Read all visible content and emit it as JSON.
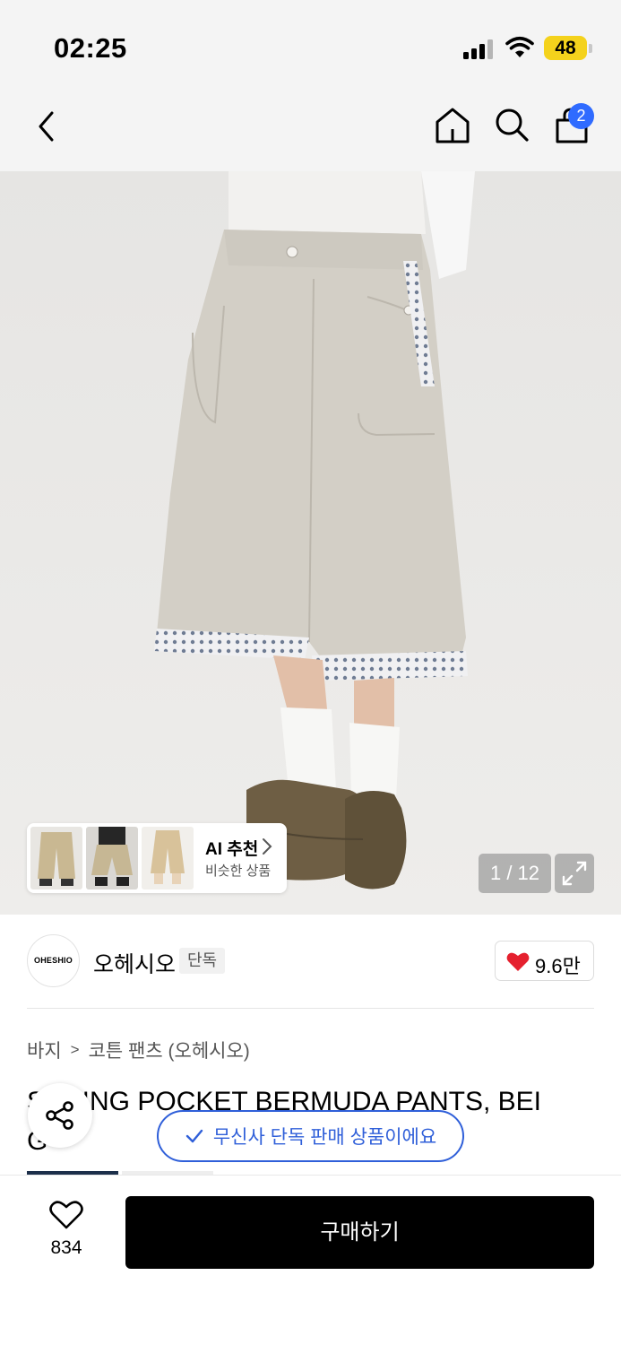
{
  "status_bar": {
    "time": "02:25",
    "battery": "48",
    "battery_color": "#f4d21c"
  },
  "nav": {
    "back_icon": "chevron-left-icon",
    "home_icon": "home-icon",
    "search_icon": "search-icon",
    "cart_icon": "shopping-bag-icon",
    "cart_badge": "2",
    "badge_color": "#2f6bff"
  },
  "gallery": {
    "ai_title": "AI 추천",
    "ai_subtitle": "비슷한 상품",
    "counter": "1 / 12",
    "expand_icon": "expand-icon"
  },
  "brand": {
    "logo_text": "OHESHIO",
    "name": "오헤시오",
    "exclusive_tag": "단독",
    "likes": "9.6만",
    "heart_color": "#e5202e"
  },
  "category": {
    "level1": "바지",
    "level2": "코튼 팬츠 (오헤시오)"
  },
  "product": {
    "title_line1": "SPRING POCKET BERMUDA PANTS, BEI",
    "title_line2": "G"
  },
  "banner": {
    "text": "무신사 단독 판매 상품이에요",
    "color": "#2f5fd9"
  },
  "bottom": {
    "wish_count": "834",
    "buy_label": "구매하기"
  }
}
